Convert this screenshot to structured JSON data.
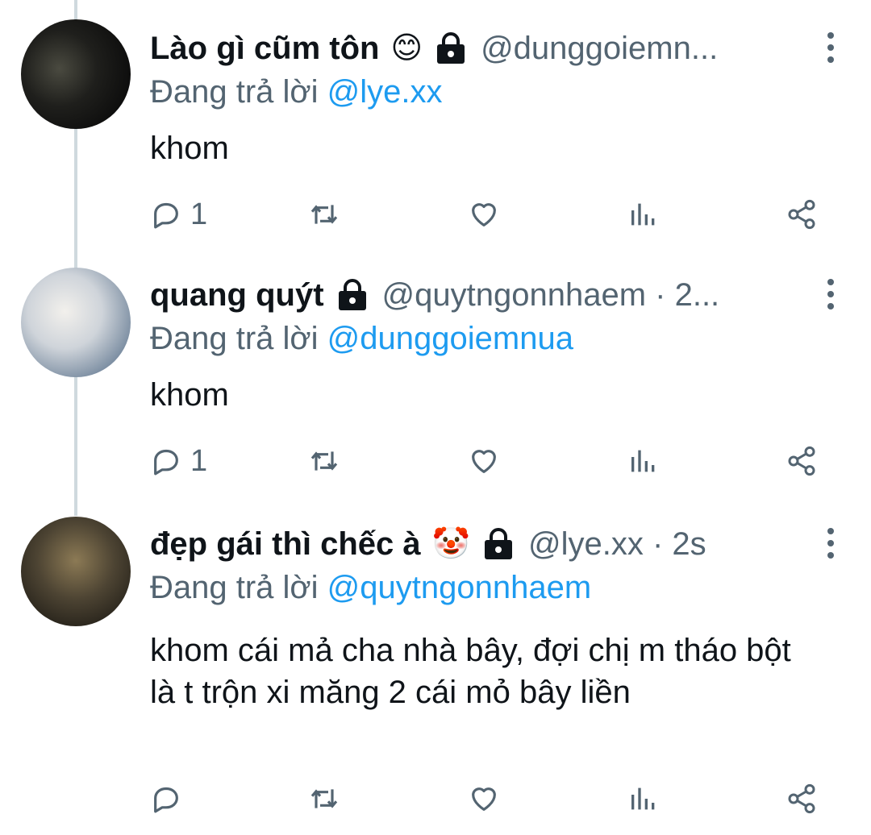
{
  "tweets": [
    {
      "name": "Lào gì cũm tôn",
      "emoji": "😊",
      "handle": "@dunggoiemn...",
      "reply_prefix": "Đang trả lời",
      "reply_to": "@lye.xx",
      "body": "khom",
      "reply_count": "1"
    },
    {
      "name": "quang quýt",
      "emoji": "",
      "handle": "@quytngonnhaem · 2...",
      "reply_prefix": "Đang trả lời",
      "reply_to": "@dunggoiemnua",
      "body": "khom",
      "reply_count": "1"
    },
    {
      "name": "đẹp gái thì chếc à",
      "emoji": "🤡",
      "handle": "@lye.xx · 2s",
      "reply_prefix": "Đang trả lời",
      "reply_to": "@quytngonnhaem",
      "body": "khom cái mả cha nhà bây, đợi chị m tháo bột là t trộn xi măng 2 cái mỏ bây liền",
      "reply_count": ""
    }
  ],
  "icons": {
    "reply": "reply-icon",
    "retweet": "retweet-icon",
    "like": "heart-icon",
    "views": "views-icon",
    "share": "share-icon",
    "lock": "lock-icon",
    "more": "more-vertical-icon"
  },
  "colors": {
    "link": "#1d9bf0",
    "secondary": "#536471",
    "thread_line": "#cfd9de"
  }
}
